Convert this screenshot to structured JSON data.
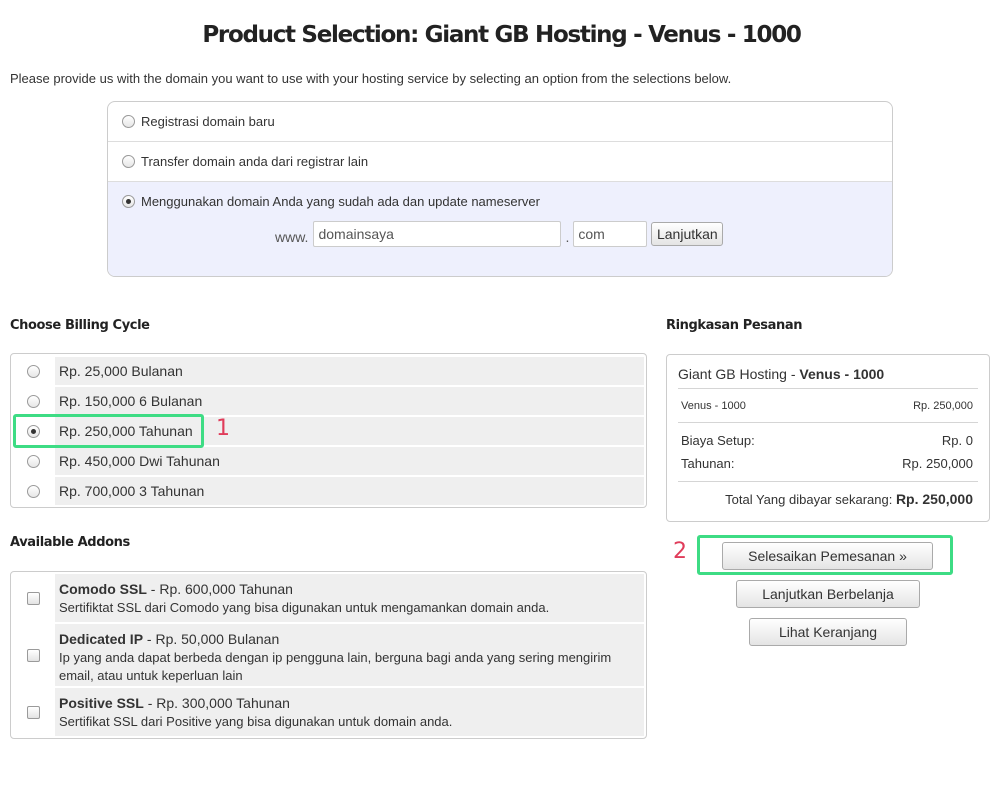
{
  "page": {
    "title": "Product Selection: Giant GB Hosting - Venus - 1000",
    "intro": "Please provide us with the domain you want to use with your hosting service by selecting an option from the selections below."
  },
  "domain": {
    "options": [
      {
        "label": "Registrasi domain baru",
        "selected": false
      },
      {
        "label": "Transfer domain anda dari registrar lain",
        "selected": false
      },
      {
        "label": "Menggunakan domain Anda yang sudah ada dan update nameserver",
        "selected": true
      }
    ],
    "prefix": "www.",
    "sld_value": "domainsaya",
    "dot": ".",
    "tld_value": "com",
    "continue_label": "Lanjutkan"
  },
  "billing": {
    "heading": "Choose Billing Cycle",
    "options": [
      {
        "label": "Rp. 25,000 Bulanan",
        "selected": false
      },
      {
        "label": "Rp. 150,000 6 Bulanan",
        "selected": false
      },
      {
        "label": "Rp. 250,000 Tahunan",
        "selected": true
      },
      {
        "label": "Rp. 450,000 Dwi Tahunan",
        "selected": false
      },
      {
        "label": "Rp. 700,000 3 Tahunan",
        "selected": false
      }
    ]
  },
  "addons": {
    "heading": "Available Addons",
    "items": [
      {
        "name": "Comodo SSL",
        "price": " - Rp. 600,000 Tahunan",
        "desc": "Sertifiktat SSL dari Comodo yang bisa digunakan untuk mengamankan domain anda.",
        "checked": false
      },
      {
        "name": "Dedicated IP",
        "price": " - Rp. 50,000 Bulanan",
        "desc": "Ip yang anda dapat berbeda dengan ip pengguna lain, berguna bagi anda yang sering mengirim email, atau untuk keperluan lain",
        "checked": false
      },
      {
        "name": "Positive SSL",
        "price": " - Rp. 300,000 Tahunan",
        "desc": "Sertifikat SSL dari Positive yang bisa digunakan untuk domain anda.",
        "checked": false
      }
    ]
  },
  "summary": {
    "heading": "Ringkasan Pesanan",
    "product_group": "Giant GB Hosting",
    "product_sep": " - ",
    "product_name": "Venus - 1000",
    "line_label": "Venus - 1000",
    "line_price": "Rp. 250,000",
    "setup_label": "Biaya Setup:",
    "setup_value": "Rp. 0",
    "cycle_label": "Tahunan:",
    "cycle_value": "Rp. 250,000",
    "total_label": "Total Yang dibayar sekarang: ",
    "total_value": "Rp. 250,000"
  },
  "actions": {
    "checkout_label": "Selesaikan Pemesanan  »",
    "continue_shopping_label": "Lanjutkan Berbelanja",
    "view_cart_label": "Lihat Keranjang"
  },
  "annotations": {
    "marker_1": "1",
    "marker_2": "2",
    "highlight_color": "#3ddc84",
    "number_color": "#e03c5a"
  }
}
